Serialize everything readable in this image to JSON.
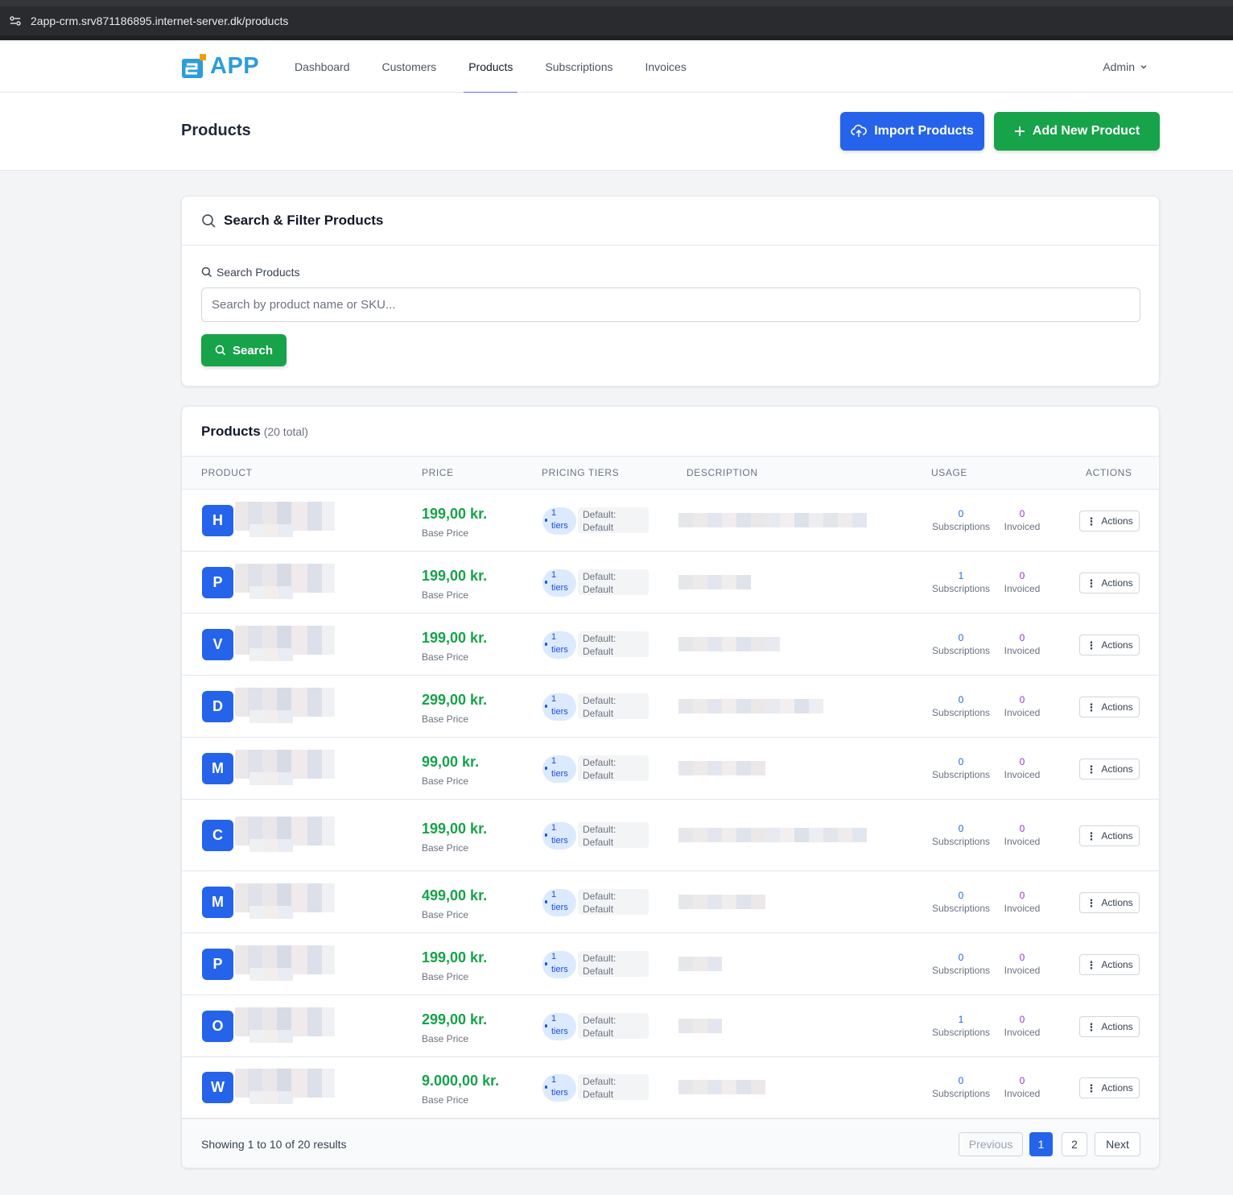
{
  "browser": {
    "url": "2app-crm.srv871186895.internet-server.dk/products"
  },
  "brand": {
    "logo_text": "APP",
    "accent": "#2563eb",
    "green": "#16a34a"
  },
  "nav": {
    "items": [
      {
        "label": "Dashboard"
      },
      {
        "label": "Customers"
      },
      {
        "label": "Products",
        "active": true
      },
      {
        "label": "Subscriptions"
      },
      {
        "label": "Invoices"
      }
    ],
    "user_label": "Admin"
  },
  "header": {
    "title": "Products",
    "import_label": "Import Products",
    "add_label": "Add New Product"
  },
  "search": {
    "card_title": "Search & Filter Products",
    "field_label": "Search Products",
    "placeholder": "Search by product name or SKU...",
    "value": "",
    "button_label": "Search"
  },
  "products": {
    "title": "Products",
    "count_label": "(20 total)",
    "columns": [
      "PRODUCT",
      "PRICE",
      "PRICING TIERS",
      "DESCRIPTION",
      "USAGE",
      "ACTIONS"
    ],
    "rows": [
      {
        "initial": "H",
        "price": "199,00 kr.",
        "price_sub": "Base Price",
        "tiers": "1",
        "tiers_word": "tiers",
        "default_1": "Default:",
        "default_2": "Default",
        "subs": "0",
        "subs_label": "Subscriptions",
        "invoiced": "0",
        "invoiced_label": "Invoiced",
        "action_label": "Actions"
      },
      {
        "initial": "P",
        "price": "199,00 kr.",
        "price_sub": "Base Price",
        "tiers": "1",
        "tiers_word": "tiers",
        "default_1": "Default:",
        "default_2": "Default",
        "subs": "1",
        "subs_label": "Subscriptions",
        "invoiced": "0",
        "invoiced_label": "Invoiced",
        "action_label": "Actions"
      },
      {
        "initial": "V",
        "price": "199,00 kr.",
        "price_sub": "Base Price",
        "tiers": "1",
        "tiers_word": "tiers",
        "default_1": "Default:",
        "default_2": "Default",
        "subs": "0",
        "subs_label": "Subscriptions",
        "invoiced": "0",
        "invoiced_label": "Invoiced",
        "action_label": "Actions"
      },
      {
        "initial": "D",
        "price": "299,00 kr.",
        "price_sub": "Base Price",
        "tiers": "1",
        "tiers_word": "tiers",
        "default_1": "Default:",
        "default_2": "Default",
        "subs": "0",
        "subs_label": "Subscriptions",
        "invoiced": "0",
        "invoiced_label": "Invoiced",
        "action_label": "Actions"
      },
      {
        "initial": "M",
        "price": "99,00 kr.",
        "price_sub": "Base Price",
        "tiers": "1",
        "tiers_word": "tiers",
        "default_1": "Default:",
        "default_2": "Default",
        "subs": "0",
        "subs_label": "Subscriptions",
        "invoiced": "0",
        "invoiced_label": "Invoiced",
        "action_label": "Actions"
      },
      {
        "initial": "C",
        "price": "199,00 kr.",
        "price_sub": "Base Price",
        "tiers": "1",
        "tiers_word": "tiers",
        "default_1": "Default:",
        "default_2": "Default",
        "subs": "0",
        "subs_label": "Subscriptions",
        "invoiced": "0",
        "invoiced_label": "Invoiced",
        "action_label": "Actions"
      },
      {
        "initial": "M",
        "price": "499,00 kr.",
        "price_sub": "Base Price",
        "tiers": "1",
        "tiers_word": "tiers",
        "default_1": "Default:",
        "default_2": "Default",
        "subs": "0",
        "subs_label": "Subscriptions",
        "invoiced": "0",
        "invoiced_label": "Invoiced",
        "action_label": "Actions"
      },
      {
        "initial": "P",
        "price": "199,00 kr.",
        "price_sub": "Base Price",
        "tiers": "1",
        "tiers_word": "tiers",
        "default_1": "Default:",
        "default_2": "Default",
        "subs": "0",
        "subs_label": "Subscriptions",
        "invoiced": "0",
        "invoiced_label": "Invoiced",
        "action_label": "Actions"
      },
      {
        "initial": "O",
        "price": "299,00 kr.",
        "price_sub": "Base Price",
        "tiers": "1",
        "tiers_word": "tiers",
        "default_1": "Default:",
        "default_2": "Default",
        "subs": "1",
        "subs_label": "Subscriptions",
        "invoiced": "0",
        "invoiced_label": "Invoiced",
        "action_label": "Actions"
      },
      {
        "initial": "W",
        "price": "9.000,00 kr.",
        "price_sub": "Base Price",
        "tiers": "1",
        "tiers_word": "tiers",
        "default_1": "Default:",
        "default_2": "Default",
        "subs": "0",
        "subs_label": "Subscriptions",
        "invoiced": "0",
        "invoiced_label": "Invoiced",
        "action_label": "Actions"
      }
    ]
  },
  "pagination": {
    "summary": "Showing 1 to 10 of 20 results",
    "previous_label": "Previous",
    "pages": [
      "1",
      "2"
    ],
    "current_page": "1",
    "next_label": "Next"
  }
}
